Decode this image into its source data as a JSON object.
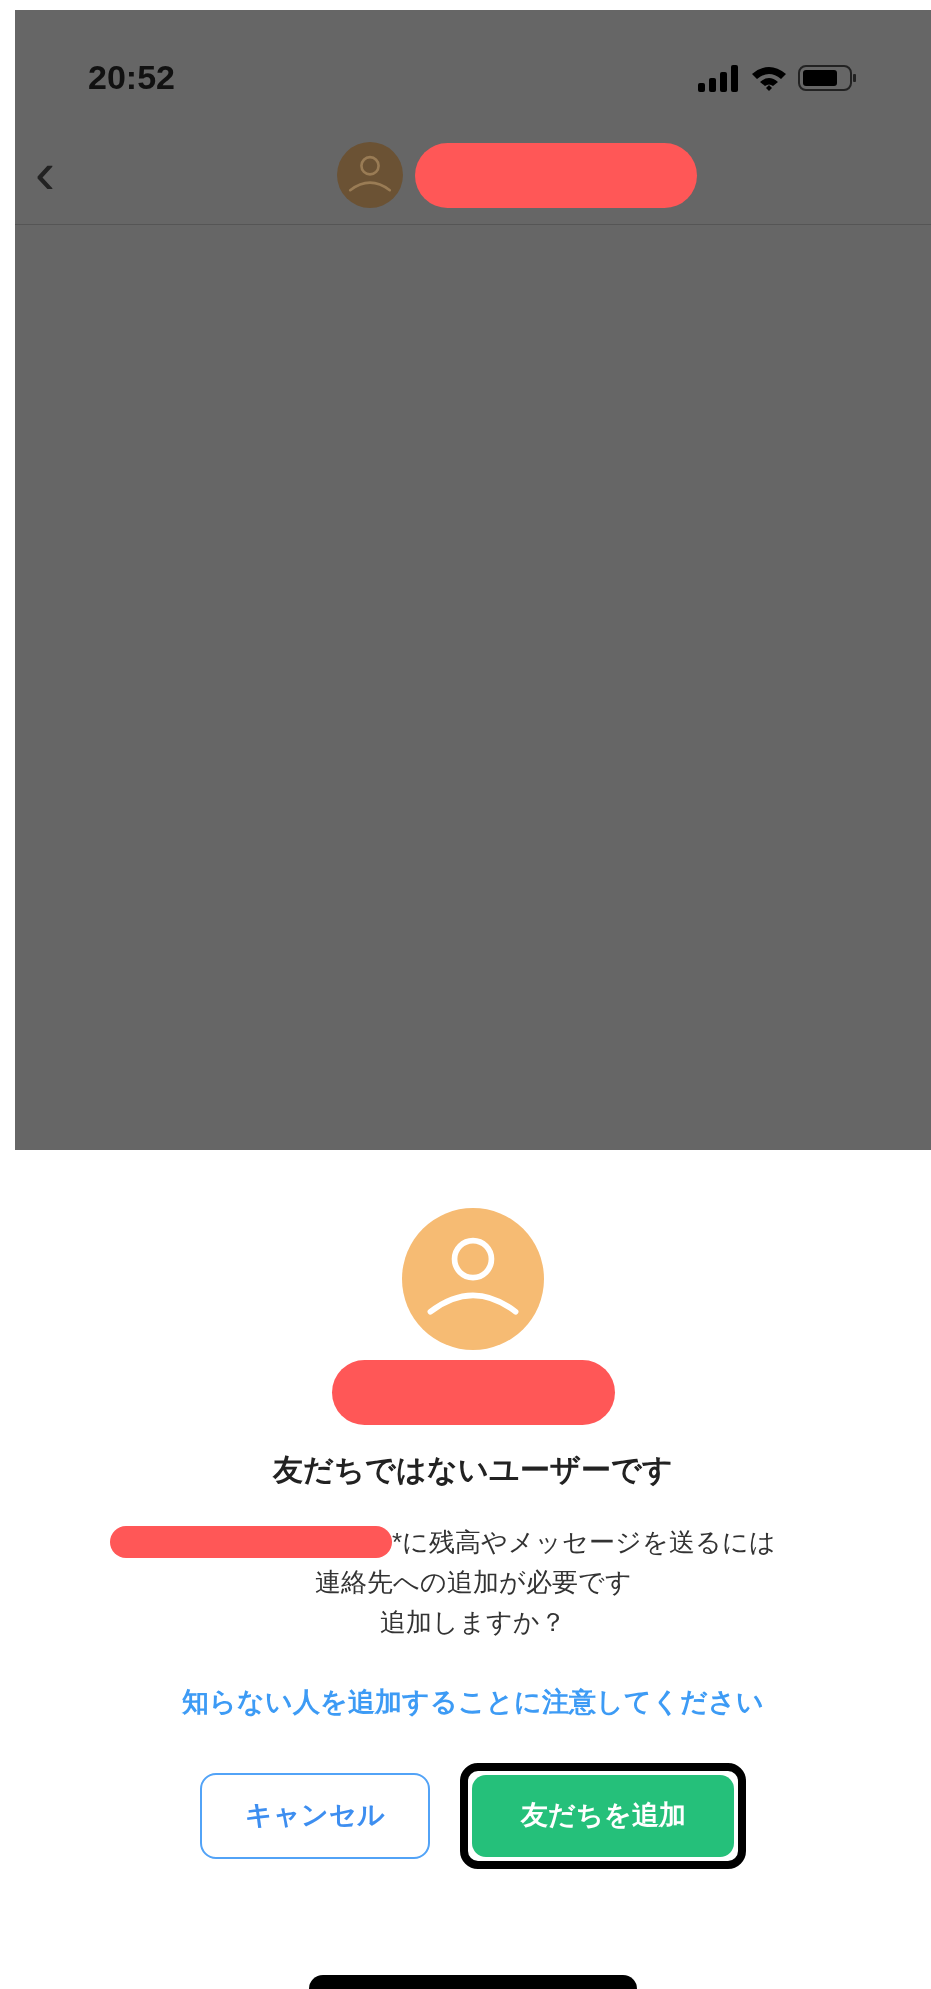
{
  "status_bar": {
    "time": "20:52"
  },
  "header": {
    "back_icon": "‹"
  },
  "sheet": {
    "title": "友だちではないユーザーです",
    "message_lines": [
      "*に残高やメッセージを送るには",
      "連絡先への追加が必要です",
      "追加しますか？"
    ],
    "warning_link": "知らない人を追加することに注意してください",
    "buttons": [
      {
        "kind": "secondary",
        "label": "キャンセル",
        "highlighted": false
      },
      {
        "kind": "primary",
        "label": "友だちを追加",
        "highlighted": true
      }
    ]
  }
}
